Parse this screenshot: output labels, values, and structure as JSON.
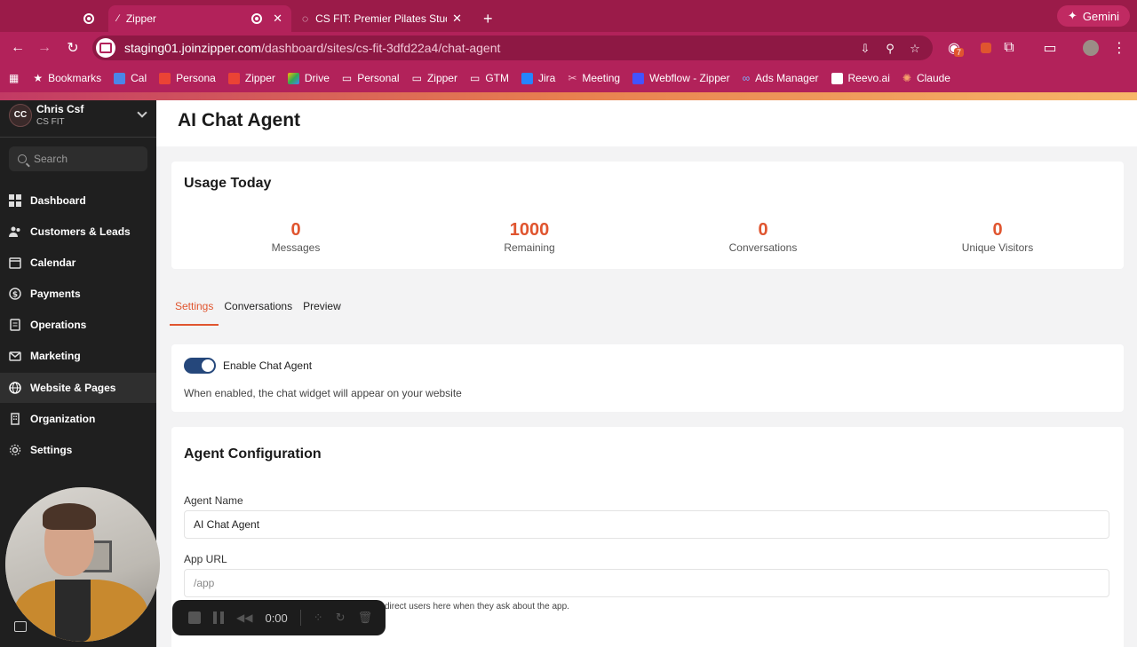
{
  "browser": {
    "tabs": [
      {
        "title": "Zipper"
      },
      {
        "title": "CS FIT: Premier Pilates Studio"
      }
    ],
    "gemini_label": "Gemini",
    "url_host": "staging01.joinzipper.com",
    "url_path": "/dashboard/sites/cs-fit-3dfd22a4/chat-agent",
    "extension_badge": "7",
    "bookmarks": [
      "Bookmarks",
      "Cal",
      "Persona",
      "Zipper",
      "Drive",
      "Personal",
      "Zipper",
      "GTM",
      "Jira",
      "Meeting",
      "Webflow - Zipper",
      "Ads Manager",
      "Reevo.ai",
      "Claude"
    ]
  },
  "sidebar": {
    "initials": "CC",
    "user_name": "Chris Csf",
    "org_name": "CS FIT",
    "search_placeholder": "Search",
    "items": [
      {
        "label": "Dashboard",
        "icon": "grid-icon"
      },
      {
        "label": "Customers & Leads",
        "icon": "users-icon"
      },
      {
        "label": "Calendar",
        "icon": "calendar-icon"
      },
      {
        "label": "Payments",
        "icon": "dollar-icon"
      },
      {
        "label": "Operations",
        "icon": "clipboard-icon"
      },
      {
        "label": "Marketing",
        "icon": "mail-icon"
      },
      {
        "label": "Website & Pages",
        "icon": "globe-icon"
      },
      {
        "label": "Organization",
        "icon": "building-icon"
      },
      {
        "label": "Settings",
        "icon": "gear-icon"
      }
    ]
  },
  "recorder": {
    "time": "0:00"
  },
  "page": {
    "title": "AI Chat Agent",
    "usage": {
      "title": "Usage Today",
      "stats": [
        {
          "value": "0",
          "label": "Messages"
        },
        {
          "value": "1000",
          "label": "Remaining"
        },
        {
          "value": "0",
          "label": "Conversations"
        },
        {
          "value": "0",
          "label": "Unique Visitors"
        }
      ]
    },
    "tabs": [
      "Settings",
      "Conversations",
      "Preview"
    ],
    "enable": {
      "label": "Enable Chat Agent",
      "help": "When enabled, the chat widget will appear on your website"
    },
    "config": {
      "title": "Agent Configuration",
      "agent_name_label": "Agent Name",
      "agent_name_value": "AI Chat Agent",
      "app_url_label": "App URL",
      "app_url_placeholder": "/app",
      "app_url_hint": "direct users here when they ask about the app."
    }
  },
  "colors": {
    "accent": "#e0552f",
    "chrome": "#b2225a",
    "sidebar": "#1f1f1f",
    "toggle": "#25477b"
  }
}
